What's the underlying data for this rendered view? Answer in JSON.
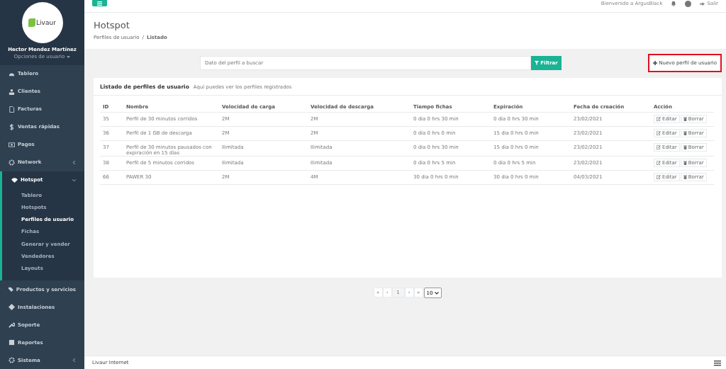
{
  "sidebar": {
    "logo": "Livaur",
    "user_name": "Hector Mendez Martínez",
    "user_options": "Opciones de usuario",
    "items": [
      {
        "label": "Tablero",
        "kind": "link",
        "expanded": false
      },
      {
        "label": "Clientes",
        "kind": "link",
        "expanded": false
      },
      {
        "label": "Facturas",
        "kind": "link",
        "expanded": false
      },
      {
        "label": "Ventas rápidas",
        "kind": "link",
        "expanded": false
      },
      {
        "label": "Pagos",
        "kind": "link",
        "expanded": false
      },
      {
        "label": "Network",
        "kind": "group",
        "expanded": false
      },
      {
        "label": "Hotspot",
        "kind": "group",
        "expanded": true,
        "children": [
          {
            "label": "Tablero",
            "selected": false
          },
          {
            "label": "Hotspots",
            "selected": false
          },
          {
            "label": "Perfiles de usuario",
            "selected": true
          },
          {
            "label": "Fichas",
            "selected": false
          },
          {
            "label": "Generar y vender",
            "selected": false
          },
          {
            "label": "Vendedores",
            "selected": false
          },
          {
            "label": "Layouts",
            "selected": false
          }
        ]
      },
      {
        "label": "Productos y servicios",
        "kind": "link",
        "expanded": false
      },
      {
        "label": "Instalaciones",
        "kind": "link",
        "expanded": false
      },
      {
        "label": "Soporte",
        "kind": "link",
        "expanded": false
      },
      {
        "label": "Reportes",
        "kind": "link",
        "expanded": false
      },
      {
        "label": "Sistema",
        "kind": "group",
        "expanded": false
      }
    ]
  },
  "topbar": {
    "welcome": "Bienvenido a ArgusBlack",
    "logout": "Salir"
  },
  "page": {
    "title": "Hotspot",
    "breadcrumb": [
      "Perfiles de usuario",
      "Listado"
    ],
    "breadcrumb_separator": "/"
  },
  "search": {
    "placeholder": "Dato del perfil a buscar",
    "filter_button": "Filtrar"
  },
  "new_button": {
    "label": "Nuevo perfil de usuario",
    "highlighted": true
  },
  "card": {
    "title": "Listado de perfiles de usuario",
    "subtitle": "Aquí puedes ver los perfiles registrados"
  },
  "table": {
    "columns": [
      "ID",
      "Nombre",
      "Velocidad de carga",
      "Velocidad de descarga",
      "Tiempo fichas",
      "Expiración",
      "Fecha de creación",
      "Acción"
    ],
    "rows": [
      {
        "cells": [
          "35",
          "Perfil de 30 minutos corridos",
          "2M",
          "2M",
          "0 dia 0 hrs 30 min",
          "0 dia 0 hrs 30 min",
          "23/02/2021"
        ],
        "actions": [
          "Editar",
          "Borrar"
        ]
      },
      {
        "cells": [
          "36",
          "Perfil de 1 GB de descarga",
          "2M",
          "2M",
          "0 dia 0 hrs 0 min",
          "15 dia 0 hrs 0 min",
          "23/02/2021"
        ],
        "actions": [
          "Editar",
          "Borrar"
        ]
      },
      {
        "cells": [
          "37",
          "Perfil de 30 minutos pausados con expiración en 15 días",
          "Ilimitada",
          "Ilimitada",
          "0 dia 0 hrs 30 min",
          "15 dia 0 hrs 0 min",
          "23/02/2021"
        ],
        "actions": [
          "Editar",
          "Borrar"
        ]
      },
      {
        "cells": [
          "38",
          "Perfil de 5 minutos corridos",
          "Ilimitada",
          "Ilimitada",
          "0 dia 0 hrs 5 min",
          "0 dia 0 hrs 5 min",
          "23/02/2021"
        ],
        "actions": [
          "Editar",
          "Borrar"
        ]
      },
      {
        "cells": [
          "66",
          "PAWER 30",
          "2M",
          "4M",
          "30 dia 0 hrs 0 min",
          "30 dia 0 hrs 0 min",
          "04/03/2021"
        ],
        "actions": [
          "Editar",
          "Borrar"
        ]
      }
    ]
  },
  "pagination": {
    "pages": [
      {
        "label": "«",
        "selected": false
      },
      {
        "label": "‹",
        "selected": false
      },
      {
        "label": "1",
        "selected": true
      },
      {
        "label": "›",
        "selected": false
      },
      {
        "label": "»",
        "selected": false
      }
    ],
    "page_size": "10"
  },
  "footer": {
    "text": "Livaur Internet"
  }
}
